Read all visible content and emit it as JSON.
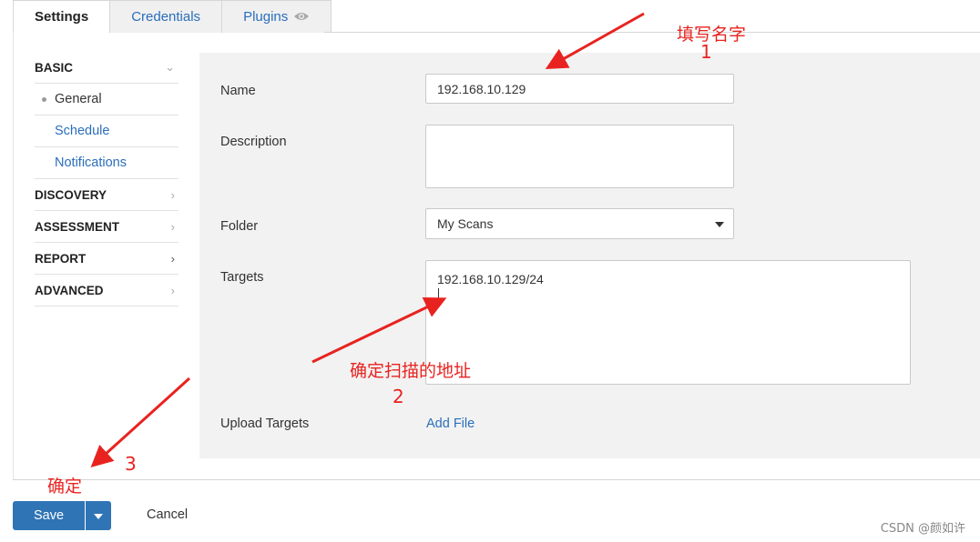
{
  "tabs": [
    {
      "label": "Settings"
    },
    {
      "label": "Credentials"
    },
    {
      "label": "Plugins"
    }
  ],
  "sidenav": {
    "basic": "BASIC",
    "general": "General",
    "schedule": "Schedule",
    "notifications": "Notifications",
    "discovery": "DISCOVERY",
    "assessment": "ASSESSMENT",
    "report": "REPORT",
    "advanced": "ADVANCED"
  },
  "form": {
    "name_label": "Name",
    "name_value": "192.168.10.129",
    "description_label": "Description",
    "description_value": "",
    "folder_label": "Folder",
    "folder_value": "My Scans",
    "targets_label": "Targets",
    "targets_value": "192.168.10.129/24",
    "upload_label": "Upload Targets",
    "add_file": "Add File"
  },
  "actions": {
    "save": "Save",
    "cancel": "Cancel"
  },
  "annotations": {
    "a1_text": "填写名字",
    "a1_num": "1",
    "a2_text": "确定扫描的地址",
    "a2_num": "2",
    "a3_text": "确定",
    "a3_num": "3",
    "color": "#e8231f"
  },
  "watermark": "CSDN @颜如许",
  "colors": {
    "accent": "#2f74b5",
    "link": "#2a6ebb",
    "panel_bg": "#f2f2f2"
  }
}
